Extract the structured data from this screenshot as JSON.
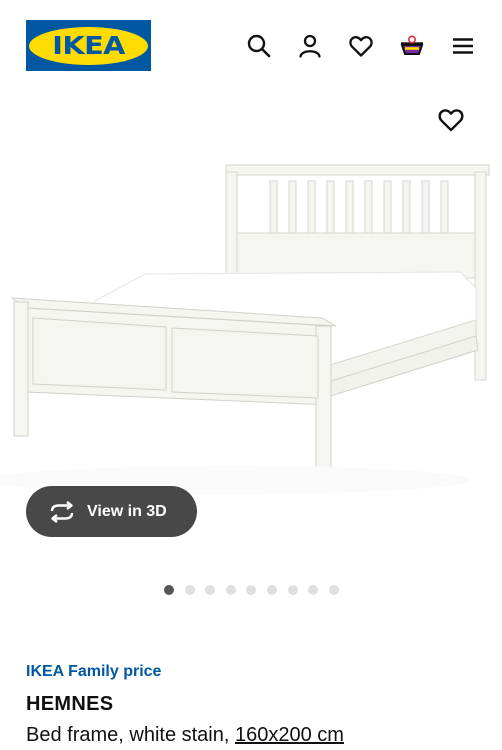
{
  "header": {
    "logo_text": "IKEA",
    "icons": [
      "search-icon",
      "profile-icon",
      "favourites-heart-icon",
      "shopping-basket-icon",
      "hamburger-menu-icon"
    ]
  },
  "product": {
    "image_icon": "product-photo-bed",
    "view3d_label": "View in 3D",
    "carousel": {
      "total": 9,
      "active": 1
    },
    "family_price_label": "IKEA Family price",
    "name": "HEMNES",
    "description": "Bed frame, white stain,",
    "size": "160x200 cm"
  },
  "colors": {
    "ikea_blue": "#0058a3",
    "ikea_yellow": "#ffdb00",
    "view3d_bg": "#484848",
    "dot_active": "#555555",
    "dot_inactive": "#dfdfdf"
  }
}
